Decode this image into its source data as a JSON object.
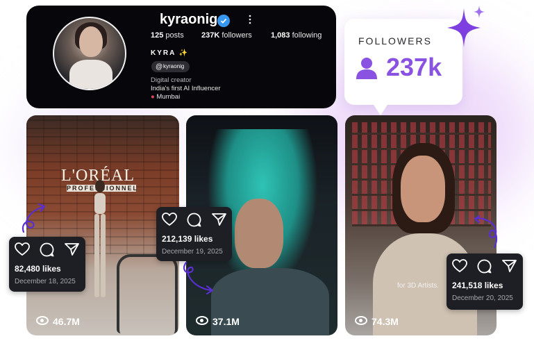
{
  "profile": {
    "username": "kyraonig",
    "stats": [
      {
        "value": "125",
        "label": "posts"
      },
      {
        "value": "237K",
        "label": "followers"
      },
      {
        "value": "1,083",
        "label": "following"
      }
    ],
    "display_name": "KYRA ✨",
    "threads_handle": "kyraonig",
    "category": "Digital creator",
    "bio": "India's first AI Influencer",
    "location": "Mumbai"
  },
  "followers_badge": {
    "label": "FOLLOWERS",
    "count": "237k"
  },
  "posts": [
    {
      "views": "46.7M",
      "brand_line1": "L'ORÉAL",
      "brand_line2": "PROFESSIONNEL",
      "likes": "82,480 likes",
      "date": "December 18, 2025"
    },
    {
      "views": "37.1M",
      "likes": "212,139 likes",
      "date": "December 19, 2025"
    },
    {
      "views": "74.3M",
      "overlay_text": "for 3D Artists.",
      "likes": "241,518 likes",
      "date": "December 20, 2025"
    }
  ],
  "colors": {
    "accent": "#8a52e0",
    "verified": "#3897f0",
    "card_dark": "#1e1f24",
    "profile_bg": "#07070b"
  }
}
